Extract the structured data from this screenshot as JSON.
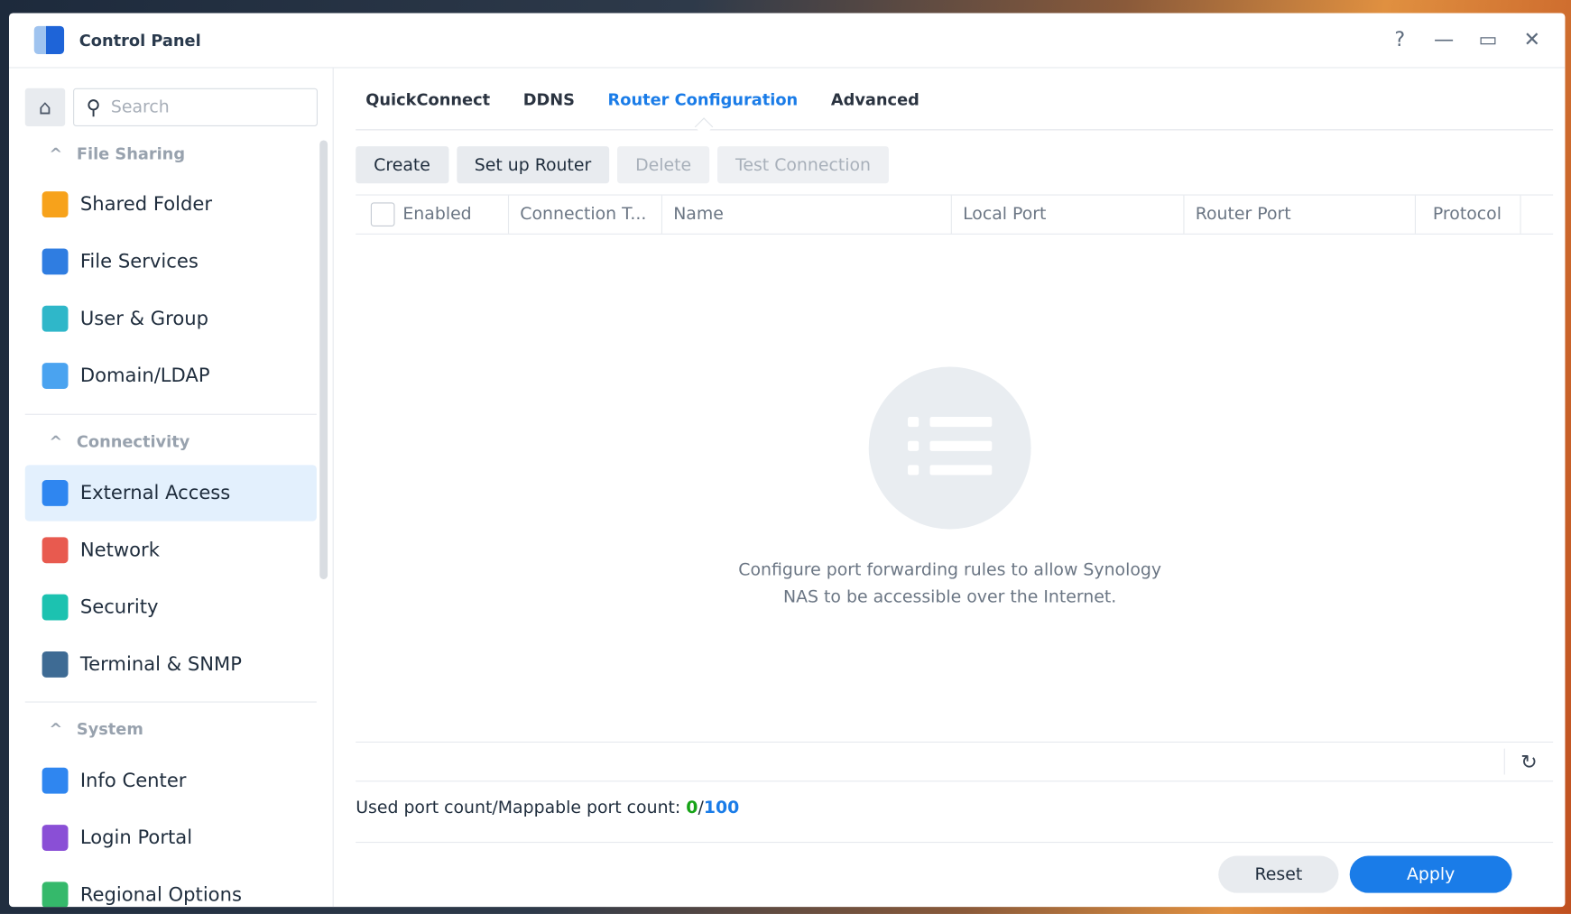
{
  "window": {
    "title": "Control Panel",
    "help": "?",
    "minimize": "—",
    "maximize": "▭",
    "close": "✕"
  },
  "sidebar": {
    "search_placeholder": "Search",
    "groups": [
      {
        "label": "File Sharing"
      },
      {
        "label": "Connectivity"
      },
      {
        "label": "System"
      }
    ],
    "items": [
      {
        "label": "Shared Folder",
        "icon": "shared-folder-icon",
        "color": "#f7a21b"
      },
      {
        "label": "File Services",
        "icon": "file-services-icon",
        "color": "#2f7de1"
      },
      {
        "label": "User & Group",
        "icon": "user-group-icon",
        "color": "#2fb7c9"
      },
      {
        "label": "Domain/LDAP",
        "icon": "domain-ldap-icon",
        "color": "#4aa3f0"
      },
      {
        "label": "External Access",
        "icon": "external-access-icon",
        "color": "#2f86f0",
        "active": true
      },
      {
        "label": "Network",
        "icon": "network-icon",
        "color": "#e85a4f"
      },
      {
        "label": "Security",
        "icon": "security-shield-icon",
        "color": "#1cc2b0"
      },
      {
        "label": "Terminal & SNMP",
        "icon": "terminal-icon",
        "color": "#3e6b94"
      },
      {
        "label": "Info Center",
        "icon": "info-center-icon",
        "color": "#2f86f0"
      },
      {
        "label": "Login Portal",
        "icon": "login-portal-icon",
        "color": "#8a4fd6"
      },
      {
        "label": "Regional Options",
        "icon": "regional-options-icon",
        "color": "#35b96b"
      }
    ]
  },
  "tabs": [
    {
      "label": "QuickConnect"
    },
    {
      "label": "DDNS"
    },
    {
      "label": "Router Configuration",
      "active": true
    },
    {
      "label": "Advanced"
    }
  ],
  "toolbar": {
    "create": "Create",
    "setup": "Set up Router",
    "delete": "Delete",
    "test": "Test Connection"
  },
  "table": {
    "columns": [
      "Enabled",
      "Connection T...",
      "Name",
      "Local Port",
      "Router Port",
      "Protocol"
    ]
  },
  "empty": {
    "line1": "Configure port forwarding rules to allow Synology",
    "line2": "NAS to be accessible over the Internet."
  },
  "port_count": {
    "label": "Used port count/Mappable port count: ",
    "used": "0",
    "sep": "/",
    "max": "100"
  },
  "buttons": {
    "reset": "Reset",
    "apply": "Apply"
  }
}
